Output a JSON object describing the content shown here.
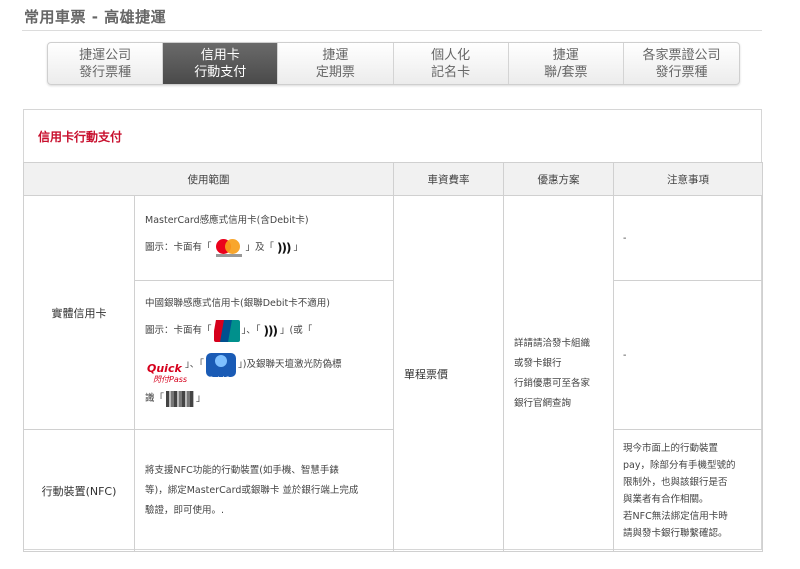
{
  "page": {
    "title": "常用車票 - 高雄捷運"
  },
  "tabs": [
    {
      "line1": "捷運公司",
      "line2": "發行票種",
      "active": false
    },
    {
      "line1": "信用卡",
      "line2": "行動支付",
      "active": true
    },
    {
      "line1": "捷運",
      "line2": "定期票",
      "active": false
    },
    {
      "line1": "個人化",
      "line2": "記名卡",
      "active": false
    },
    {
      "line1": "捷運",
      "line2": "聯/套票",
      "active": false
    },
    {
      "line1": "各家票證公司",
      "line2": "發行票種",
      "active": false
    }
  ],
  "panel": {
    "title": "信用卡行動支付"
  },
  "table": {
    "headers": [
      "使用範圍",
      "車資費率",
      "優惠方案",
      "注意事項"
    ],
    "physical_card": {
      "category": "實體信用卡",
      "mastercard_desc": "MasterCard感應式信用卡(含Debit卡)",
      "mastercard_icon_prefix": "圖示：卡面有「",
      "mastercard_icon_mid": "」及「",
      "mastercard_icon_suffix": "」",
      "unionpay_desc": "中國銀聯感應式信用卡(銀聯Debit卡不適用)",
      "unionpay_icon_prefix": "圖示：卡面有「",
      "unionpay_icon_mid1": "」、「",
      "unionpay_icon_mid2": "」(或「",
      "unionpay_icon_mid3": "」、「",
      "unionpay_icon_mid4": "」)及銀聯天壇激光防偽標",
      "unionpay_icon_line3_prefix": "識「",
      "unionpay_icon_line3_suffix": "」",
      "nfc_symbol": ")))",
      "quick_text": "Quick",
      "quick_sub": "閃付Pass",
      "quickpass_text": "QuickPass",
      "mastercard_note": "-",
      "unionpay_note": "-"
    },
    "fare": "單程票價",
    "discount_lines": [
      "詳請請洽發卡組織",
      "或發卡銀行",
      "行銷優惠可至各家",
      "銀行官網查詢"
    ],
    "mobile": {
      "category": "行動裝置(NFC)",
      "desc_lines": [
        "將支援NFC功能的行動裝置(如手機、智慧手錶",
        "等)，綁定MasterCard或銀聯卡 並於銀行端上完成",
        "驗證，即可使用。."
      ],
      "note_lines": [
        "現今市面上的行動裝置",
        "pay，除部分有手機型號的",
        "限制外，也與該銀行是否",
        "與業者有合作相關。",
        "若NFC無法綁定信用卡時",
        "請與發卡銀行聯繫確認。"
      ]
    }
  },
  "colors": {
    "accent_red": "#c8102e",
    "active_tab": "#555555",
    "header_bg": "#f1f1f1"
  }
}
